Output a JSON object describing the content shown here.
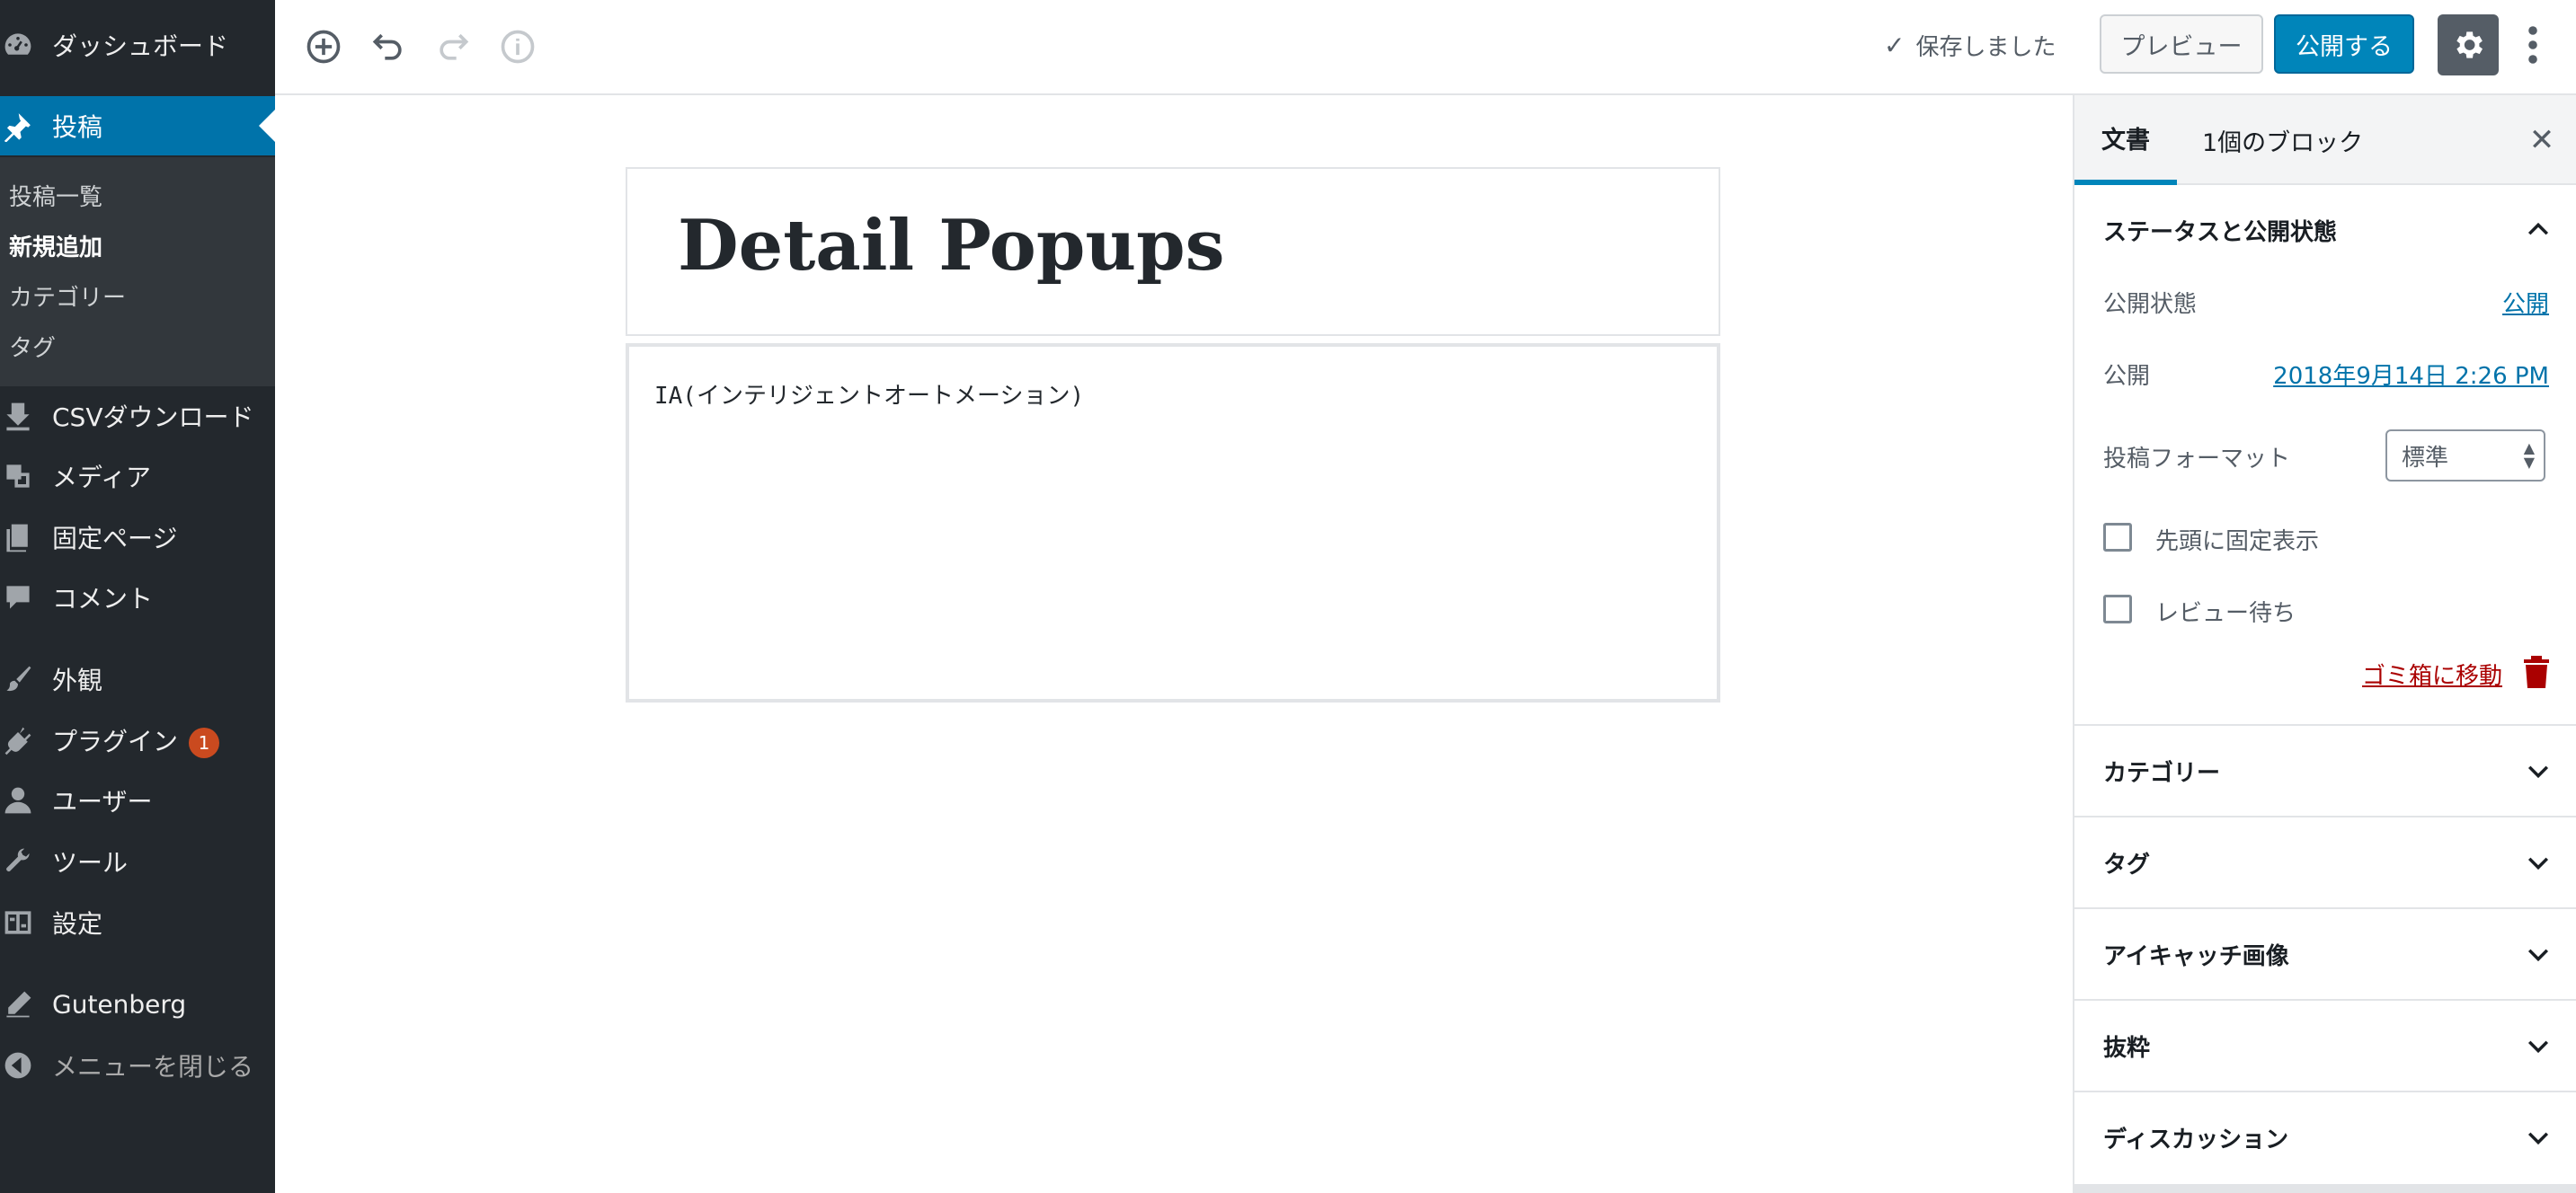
{
  "admin_menu": {
    "items": [
      {
        "label": "ダッシュボード",
        "icon": "dashboard-icon"
      },
      {
        "label": "投稿",
        "icon": "pin-icon",
        "current": true
      },
      {
        "label": "CSVダウンロード",
        "icon": "download-icon"
      },
      {
        "label": "メディア",
        "icon": "media-icon"
      },
      {
        "label": "固定ページ",
        "icon": "pages-icon"
      },
      {
        "label": "コメント",
        "icon": "comment-icon"
      },
      {
        "label": "外観",
        "icon": "brush-icon"
      },
      {
        "label": "プラグイン",
        "icon": "plugin-icon",
        "badge": "1"
      },
      {
        "label": "ユーザー",
        "icon": "user-icon"
      },
      {
        "label": "ツール",
        "icon": "wrench-icon"
      },
      {
        "label": "設定",
        "icon": "settings-icon"
      },
      {
        "label": "Gutenberg",
        "icon": "pencil-icon"
      },
      {
        "label": "メニューを閉じる",
        "icon": "collapse-icon"
      }
    ],
    "submenu": [
      "投稿一覧",
      "新規追加",
      "カテゴリー",
      "タグ"
    ]
  },
  "toolbar": {
    "icons": [
      "add-block-icon",
      "undo-icon",
      "redo-icon",
      "info-icon"
    ],
    "saved_label": "保存しました",
    "preview_label": "プレビュー",
    "publish_label": "公開する"
  },
  "editor": {
    "title": "Detail Popups",
    "content": "IA(インテリジェントオートメーション)"
  },
  "sidebar": {
    "tabs": [
      "文書",
      "1個のブロック"
    ],
    "status_panel": {
      "title": "ステータスと公開状態",
      "visibility_label": "公開状態",
      "visibility_value": "公開",
      "publish_label": "公開",
      "publish_value": "2018年9月14日 2:26 PM",
      "format_label": "投稿フォーマット",
      "format_value": "標準",
      "sticky_label": "先頭に固定表示",
      "pending_label": "レビュー待ち",
      "trash_label": "ゴミ箱に移動"
    },
    "panels": [
      "カテゴリー",
      "タグ",
      "アイキャッチ画像",
      "抜粋",
      "ディスカッション"
    ]
  },
  "colors": {
    "admin_bg": "#23282d",
    "submenu_bg": "#32373c",
    "accent": "#0085ba",
    "link": "#0073aa",
    "danger": "#aa0000",
    "badge": "#ca4a1f"
  }
}
